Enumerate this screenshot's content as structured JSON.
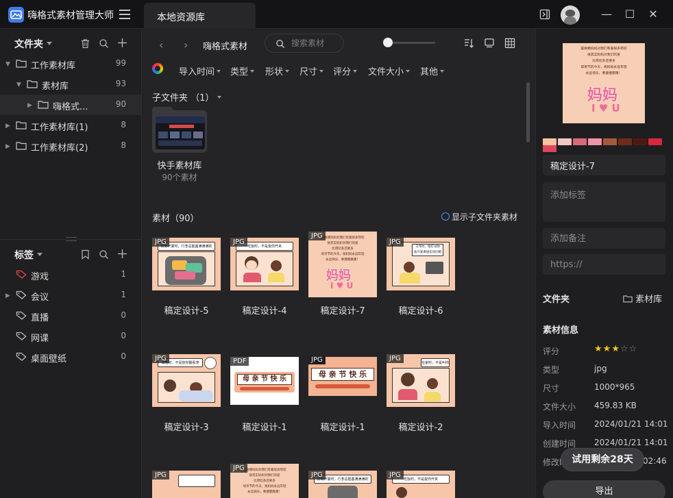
{
  "app": {
    "title": "嗨格式素材管理大师",
    "tab": "本地资源库"
  },
  "sidebar": {
    "folders_title": "文件夹",
    "tree": [
      {
        "label": "工作素材库",
        "count": "99"
      },
      {
        "label": "素材库",
        "count": "93"
      },
      {
        "label": "嗨格式...",
        "count": "90"
      },
      {
        "label": "工作素材库(1)",
        "count": "8"
      },
      {
        "label": "工作素材库(2)",
        "count": "8"
      }
    ],
    "tags_title": "标签",
    "tags": [
      {
        "label": "游戏",
        "count": "1",
        "color": "#e5484d"
      },
      {
        "label": "会议",
        "count": "1"
      },
      {
        "label": "直播",
        "count": "0"
      },
      {
        "label": "网课",
        "count": "0"
      },
      {
        "label": "桌面壁纸",
        "count": "0"
      }
    ]
  },
  "toolbar": {
    "breadcrumb": "嗨格式素材",
    "search_placeholder": "搜索素材",
    "filters": [
      "导入时间",
      "类型",
      "形状",
      "尺寸",
      "评分",
      "文件大小",
      "其他"
    ]
  },
  "content": {
    "subfolder_header": "子文件夹 （1）",
    "subfolder": {
      "name": "快手素材库",
      "count": "90个素材"
    },
    "materials_header": "素材（90）",
    "show_sub_label": "显示子文件夹素材",
    "items": [
      {
        "badge": "JPG",
        "name": "稿定设计-5"
      },
      {
        "badge": "JPG",
        "name": "稿定设计-4"
      },
      {
        "badge": "JPG",
        "name": "稿定设计-7"
      },
      {
        "badge": "JPG",
        "name": "稿定设计-6"
      },
      {
        "badge": "JPG",
        "name": "稿定设计-3"
      },
      {
        "badge": "PDF",
        "name": "稿定设计-1"
      },
      {
        "badge": "JPG",
        "name": "稿定设计-1"
      },
      {
        "badge": "JPG",
        "name": "稿定设计-2"
      },
      {
        "badge": "JPG",
        "name": ""
      },
      {
        "badge": "JPG",
        "name": ""
      },
      {
        "badge": "JPG",
        "name": ""
      },
      {
        "badge": "JPG",
        "name": ""
      }
    ],
    "thumb_texts": {
      "t5": "报离开宴时，行李总能塞满满满的",
      "t4": "吃饭时，不是拔你开夹",
      "t6": "工作时，咱打试你",
      "t6b": "总只发发短信问问咱",
      "t3": "消着时，不是放你翻看宠",
      "t2": "在家时，不是叫你买手机",
      "mother_day": "母 亲 节 快 乐",
      "poster_lines": [
        "是故哪妈妈对我们有着很多唠叨",
        "很其实妈妈对我们的爱",
        "比唠叨多还要多",
        "母亲节的今天，祝妈妈永远年轻",
        "永远快乐，要健健康康！"
      ],
      "poster_title": "妈妈",
      "poster_sub": "I ♥ U"
    }
  },
  "right_panel": {
    "palette": [
      "#f4c3a1",
      "#f2c6c3",
      "#d96a77",
      "#ee93a8",
      "#a45a3a",
      "#6e2c18",
      "#4b1b10",
      "#d7283b",
      "#e0455d"
    ],
    "name_value": "稿定设计-7",
    "tag_placeholder": "添加标签",
    "note_placeholder": "添加备注",
    "url_placeholder": "https://",
    "folder_label": "文件夹",
    "folder_value": "素材库",
    "info_title": "素材信息",
    "rating": 3,
    "rating_max": 5,
    "info": [
      {
        "k": "评分",
        "v": ""
      },
      {
        "k": "类型",
        "v": "jpg"
      },
      {
        "k": "尺寸",
        "v": "1000*965"
      },
      {
        "k": "文件大小",
        "v": "459.83 KB"
      },
      {
        "k": "导入时间",
        "v": "2024/01/21 14:01"
      },
      {
        "k": "创建时间",
        "v": "2024/01/21 14:01"
      },
      {
        "k": "修改时间",
        "v": "02:46"
      }
    ],
    "trial_label": "试用剩余28天",
    "export_label": "导出"
  },
  "icons": [
    "menu-icon",
    "sidebar-toggle-icon",
    "avatar",
    "minimize-icon",
    "maximize-icon",
    "close-icon",
    "trash-icon",
    "search-icon",
    "plus-icon",
    "folder-icon",
    "tag-icon",
    "bookmark-icon",
    "sort-icon",
    "preview-icon",
    "grid-icon",
    "check-circle-icon",
    "star-icon"
  ]
}
